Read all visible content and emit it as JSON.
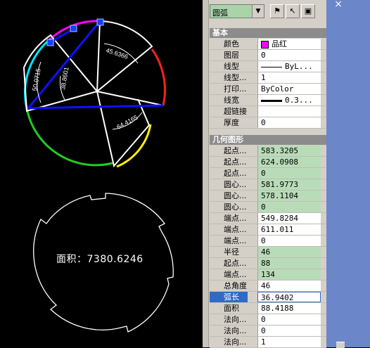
{
  "drawing": {
    "dims": {
      "left": "50.0715",
      "mid": "38.8601",
      "top": "45.6366",
      "bottom": "64.4165"
    },
    "area_label": "面积：7380.6246"
  },
  "palette": {
    "close_glyph": "×",
    "toolbar": {
      "object_type": "圆弧",
      "dropdown_glyph": "▼",
      "btn_quickselect": "⚑",
      "btn_select": "↖",
      "btn_toggle": "▣"
    },
    "sections": {
      "basic": "基本",
      "geometry": "几何图形"
    },
    "basic": [
      {
        "key": "颜色",
        "value": "品红",
        "kind": "swatch",
        "swatch_color": "#ff00ff"
      },
      {
        "key": "图层",
        "value": "0"
      },
      {
        "key": "线型",
        "value": "ByL...",
        "kind": "line"
      },
      {
        "key": "线型...",
        "value": "1"
      },
      {
        "key": "打印...",
        "value": "ByColor"
      },
      {
        "key": "线宽",
        "value": "0.3...",
        "kind": "thickline"
      },
      {
        "key": "超链接",
        "value": ""
      },
      {
        "key": "厚度",
        "value": "0"
      }
    ],
    "geometry": [
      {
        "key": "起点...",
        "value": "583.3205",
        "green": true
      },
      {
        "key": "起点...",
        "value": "624.0908",
        "green": true
      },
      {
        "key": "起点...",
        "value": "0",
        "green": true
      },
      {
        "key": "圆心...",
        "value": "581.9773",
        "green": true
      },
      {
        "key": "圆心...",
        "value": "578.1104",
        "green": true
      },
      {
        "key": "圆心...",
        "value": "0",
        "green": true
      },
      {
        "key": "端点...",
        "value": "549.8284",
        "green": false
      },
      {
        "key": "端点...",
        "value": "611.011",
        "green": false
      },
      {
        "key": "端点...",
        "value": "0",
        "green": false
      },
      {
        "key": "半径",
        "value": "46",
        "green": true
      },
      {
        "key": "起点...",
        "value": "88",
        "green": true
      },
      {
        "key": "端点...",
        "value": "134",
        "green": true
      },
      {
        "key": "总角度",
        "value": "46",
        "green": false
      },
      {
        "key": "弧长",
        "value": "36.9402",
        "green": false,
        "selected": true
      },
      {
        "key": "面积",
        "value": "88.4188",
        "green": false
      },
      {
        "key": "法向...",
        "value": "0",
        "green": false
      },
      {
        "key": "法向...",
        "value": "0",
        "green": false
      },
      {
        "key": "法向...",
        "value": "1",
        "green": false
      }
    ]
  }
}
